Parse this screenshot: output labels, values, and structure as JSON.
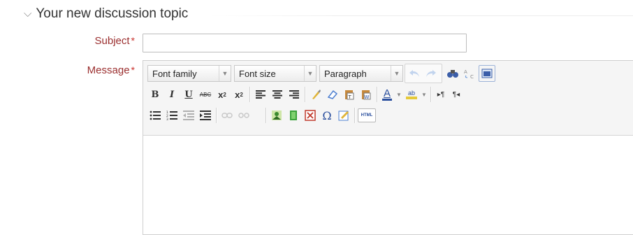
{
  "section": {
    "chevron": "chevron-down-icon",
    "title": "Your new discussion topic"
  },
  "form": {
    "subject_label": "Subject",
    "message_label": "Message",
    "required_mark": "*",
    "subject_value": ""
  },
  "toolbar": {
    "font_family": "Font family",
    "font_size": "Font size",
    "paragraph": "Paragraph",
    "html_label": "HTML"
  },
  "colors": {
    "label": "#9b2f2f",
    "required": "#c9302c"
  }
}
